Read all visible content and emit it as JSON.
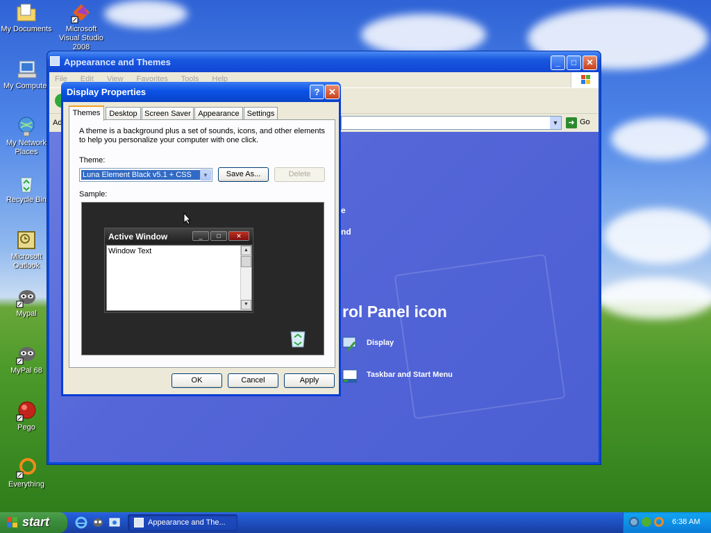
{
  "desktop": {
    "icons": [
      {
        "label": "My Documents"
      },
      {
        "label": "Microsoft Visual Studio 2008"
      },
      {
        "label": "My Computer"
      },
      {
        "label": "My Network Places"
      },
      {
        "label": "Recycle Bin"
      },
      {
        "label": "Microsoft Outlook"
      },
      {
        "label": "Mypal"
      },
      {
        "label": "MyPal 68"
      },
      {
        "label": "Pego"
      },
      {
        "label": "Everything"
      }
    ]
  },
  "explorer": {
    "title": "Appearance and Themes",
    "menu": [
      "File",
      "Edit",
      "View",
      "Favorites",
      "Tools",
      "Help"
    ],
    "address_label": "Ad",
    "go_label": "Go",
    "body": {
      "fragment_1": "e",
      "fragment_2": "nd",
      "heading": "rol Panel icon",
      "links": [
        {
          "label": "Display"
        },
        {
          "label": "Taskbar and Start Menu"
        }
      ]
    }
  },
  "dialog": {
    "title": "Display Properties",
    "help_glyph": "?",
    "close_glyph": "✕",
    "tabs": [
      {
        "label": "Themes",
        "active": true
      },
      {
        "label": "Desktop",
        "active": false
      },
      {
        "label": "Screen Saver",
        "active": false
      },
      {
        "label": "Appearance",
        "active": false
      },
      {
        "label": "Settings",
        "active": false
      }
    ],
    "description": "A theme is a background plus a set of sounds, icons, and other elements to help you personalize your computer with one click.",
    "theme_label": "Theme:",
    "theme_value": "Luna Element Black v5.1 + CSS",
    "save_as_label": "Save As...",
    "delete_label": "Delete",
    "sample_label": "Sample:",
    "sample_window": {
      "title": "Active Window",
      "body_text": "Window Text"
    },
    "ok_label": "OK",
    "cancel_label": "Cancel",
    "apply_label": "Apply"
  },
  "taskbar": {
    "start_label": "start",
    "task_button_label": "Appearance and The...",
    "clock": "6:38 AM"
  },
  "colors": {
    "titlebar": "#0b52e6",
    "explorer_body": "#5466d8",
    "dialog_face": "#ece9d8",
    "start_green": "#3c8f3c",
    "tray_blue": "#0b7fda"
  }
}
